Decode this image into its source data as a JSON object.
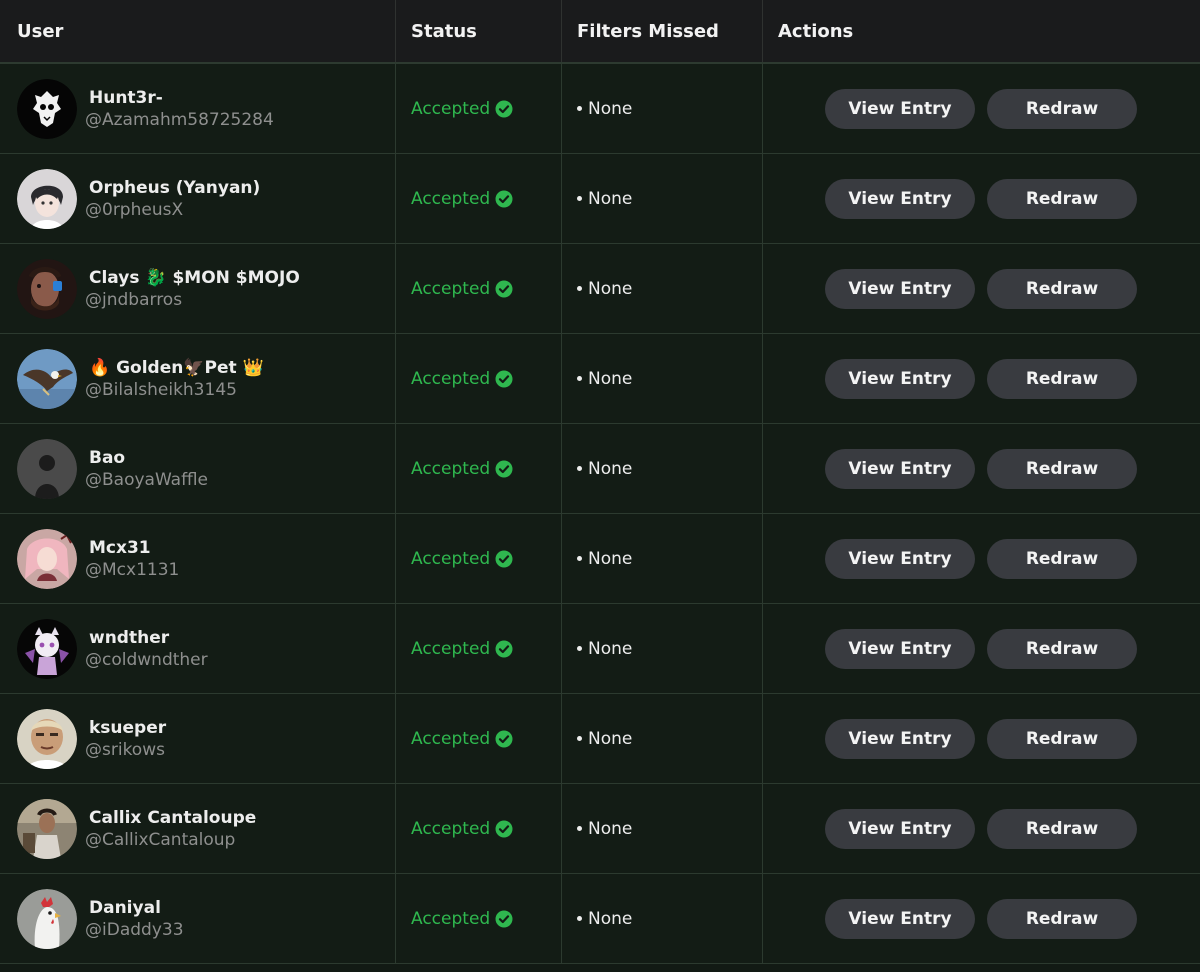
{
  "headers": {
    "user": "User",
    "status": "Status",
    "filters": "Filters Missed",
    "actions": "Actions"
  },
  "labels": {
    "view_entry": "View Entry",
    "redraw": "Redraw"
  },
  "colors": {
    "accepted": "#2fb84f",
    "button_bg": "#393b40",
    "row_bg": "#131c15",
    "header_bg": "#1a1b1c"
  },
  "rows": [
    {
      "name": "Hunt3r-",
      "handle": "@Azamahm58725284",
      "status": "Accepted",
      "filter": "None",
      "avatar": "skull-logo-avatar"
    },
    {
      "name": "Orpheus (Yanyan)",
      "handle": "@0rpheusX",
      "status": "Accepted",
      "filter": "None",
      "avatar": "anime-avatar"
    },
    {
      "name": "Clays 🐉 $MON $MOJO",
      "handle": "@jndbarros",
      "status": "Accepted",
      "filter": "None",
      "avatar": "face-avatar"
    },
    {
      "name": "🔥 Golden🦅Pet 👑",
      "handle": "@Bilalsheikh3145",
      "status": "Accepted",
      "filter": "None",
      "avatar": "eagle-avatar"
    },
    {
      "name": "Bao",
      "handle": "@BaoyaWaffle",
      "status": "Accepted",
      "filter": "None",
      "avatar": "silhouette-avatar"
    },
    {
      "name": "Mcx31",
      "handle": "@Mcx1131",
      "status": "Accepted",
      "filter": "None",
      "avatar": "pink-avatar"
    },
    {
      "name": "wndther",
      "handle": "@coldwndther",
      "status": "Accepted",
      "filter": "None",
      "avatar": "chibi-avatar"
    },
    {
      "name": "ksueper",
      "handle": "@srikows",
      "status": "Accepted",
      "filter": "None",
      "avatar": "meme-face-avatar"
    },
    {
      "name": "Callix Cantaloupe",
      "handle": "@CallixCantaloup",
      "status": "Accepted",
      "filter": "None",
      "avatar": "photo-avatar"
    },
    {
      "name": "Daniyal",
      "handle": "@iDaddy33",
      "status": "Accepted",
      "filter": "None",
      "avatar": "chicken-avatar"
    }
  ]
}
